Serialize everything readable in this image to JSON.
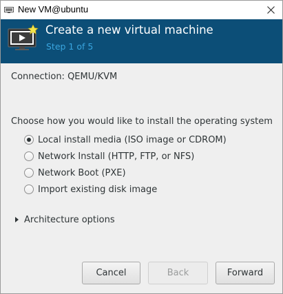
{
  "window": {
    "title": "New VM@ubuntu"
  },
  "header": {
    "title": "Create a new virtual machine",
    "step": "Step 1 of 5"
  },
  "connection": {
    "text": "Connection: QEMU/KVM"
  },
  "install": {
    "prompt": "Choose how you would like to install the operating system",
    "options": [
      {
        "label": "Local install media (ISO image or CDROM)",
        "selected": true
      },
      {
        "label": "Network Install (HTTP, FTP, or NFS)",
        "selected": false
      },
      {
        "label": "Network Boot (PXE)",
        "selected": false
      },
      {
        "label": "Import existing disk image",
        "selected": false
      }
    ]
  },
  "architecture": {
    "label": "Architecture options",
    "expanded": false
  },
  "buttons": {
    "cancel": "Cancel",
    "back": "Back",
    "forward": "Forward"
  },
  "colors": {
    "header_bg": "#0c4e77",
    "step_text": "#39a5df"
  },
  "icons": {
    "app": "virt-manager-icon",
    "header": "vm-monitor-star-icon",
    "close": "close-icon",
    "expander": "triangle-right-icon"
  }
}
